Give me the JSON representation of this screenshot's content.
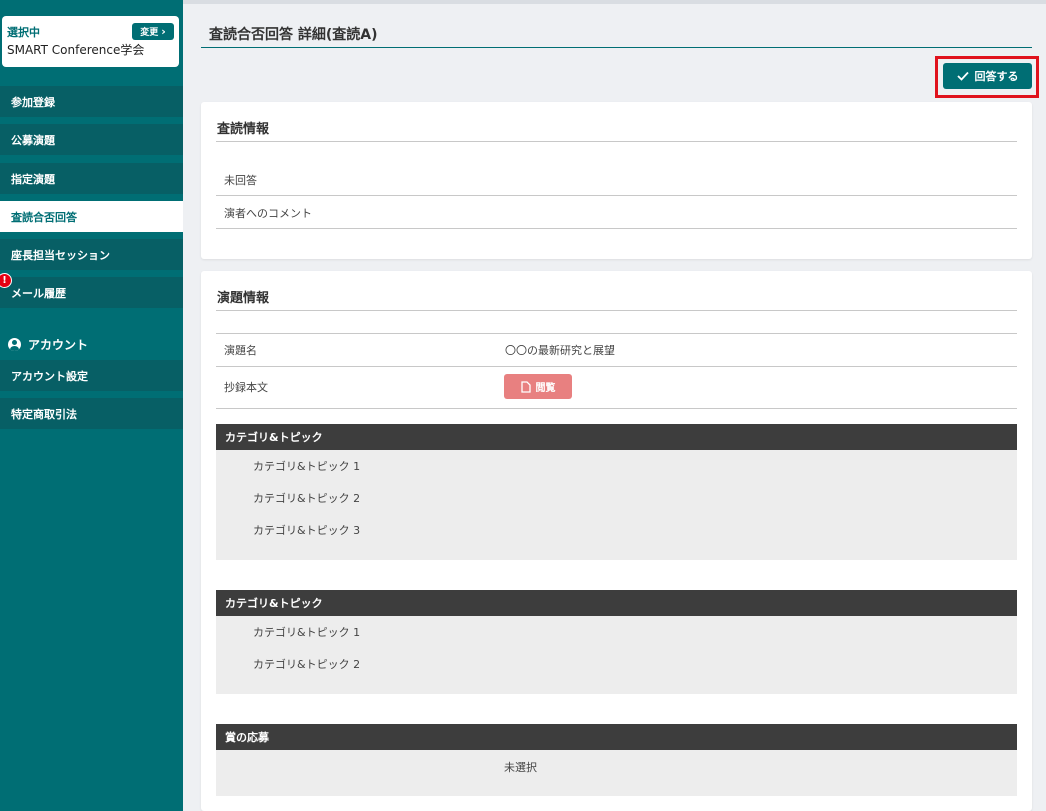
{
  "sidebar": {
    "selected_label": "選択中",
    "conference_name": "SMART Conference学会",
    "change_label": "変更",
    "items": [
      {
        "label": "参加登録",
        "active": false
      },
      {
        "label": "公募演題",
        "active": false
      },
      {
        "label": "指定演題",
        "active": false
      },
      {
        "label": "査読合否回答",
        "active": true
      },
      {
        "label": "座長担当セッション",
        "active": false
      },
      {
        "label": "メール履歴",
        "active": false,
        "alert": "!"
      }
    ],
    "account_header": "アカウント",
    "account_items": [
      {
        "label": "アカウント設定"
      },
      {
        "label": "特定商取引法"
      }
    ]
  },
  "main": {
    "title": "査読合否回答 詳細(査読A)",
    "answer_button": "回答する",
    "review_section": {
      "title": "査読情報",
      "rows": [
        "未回答",
        "演者へのコメント"
      ]
    },
    "abstract_section": {
      "title": "演題情報",
      "title_label": "演題名",
      "title_value": "〇〇の最新研究と展望",
      "body_label": "抄録本文",
      "view_button": "閲覧",
      "blocks": [
        {
          "header": "カテゴリ&トピック",
          "items": [
            "カテゴリ&トピック 1",
            "カテゴリ&トピック 2",
            "カテゴリ&トピック 3"
          ]
        },
        {
          "header": "カテゴリ&トピック",
          "items": [
            "カテゴリ&トピック 1",
            "カテゴリ&トピック 2"
          ]
        },
        {
          "header": "賞の応募",
          "value": "未選択"
        }
      ]
    }
  },
  "colors": {
    "brand": "#006e74",
    "highlight": "#e0131d",
    "view_button": "#e88080",
    "block_header": "#3d3d3d"
  }
}
